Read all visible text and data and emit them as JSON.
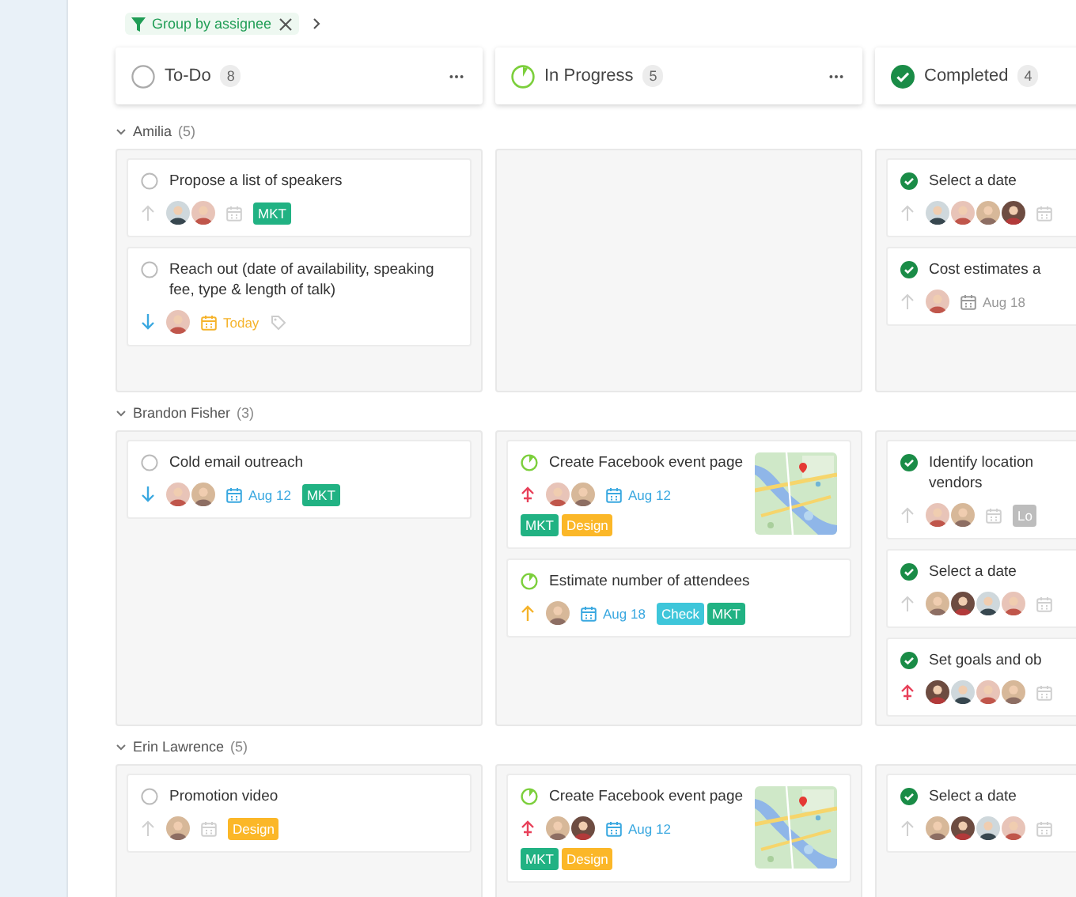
{
  "toolbar": {
    "filter_chip": {
      "label": "Group by assignee"
    },
    "next": true
  },
  "columns": [
    {
      "title": "To-Do",
      "count": "8",
      "kind": "todo"
    },
    {
      "title": "In Progress",
      "count": "5",
      "kind": "progress"
    },
    {
      "title": "Completed",
      "count": "4",
      "kind": "done"
    }
  ],
  "groups": [
    {
      "name": "Amilia",
      "count": "(5)",
      "expanded": true,
      "lanes": [
        {
          "kind": "cards",
          "cards": [
            {
              "title": "Propose a list of speakers",
              "kind": "todo",
              "priority": {
                "kind": "none"
              },
              "avatars": [
                {
                  "kind": "picture"
                },
                {
                  "kind": "picture"
                }
              ],
              "due": {
                "kind": "none"
              },
              "tags": [
                {
                  "label": "MKT",
                  "color": "#21b283"
                }
              ]
            },
            {
              "title": "Reach out (date of availability, speaking fee, type & length of talk)",
              "kind": "todo",
              "priority": {
                "kind": "low"
              },
              "avatars": [
                {
                  "kind": "picture"
                }
              ],
              "due": {
                "kind": "today",
                "label": "Today"
              },
              "tag_icon": true
            }
          ]
        },
        {
          "kind": "empty"
        },
        {
          "kind": "cards",
          "cards": [
            {
              "title": "Select a date",
              "kind": "done",
              "priority": {
                "kind": "none"
              },
              "avatars": [
                {
                  "kind": "picture"
                },
                {
                  "kind": "picture"
                },
                {
                  "kind": "picture"
                },
                {
                  "kind": "picture"
                }
              ],
              "due": {
                "kind": "none"
              }
            },
            {
              "title": "Cost estimates a",
              "kind": "done",
              "priority": {
                "kind": "none"
              },
              "avatars": [
                {
                  "kind": "picture"
                }
              ],
              "due": {
                "kind": "past",
                "label": "Aug 18"
              }
            }
          ]
        }
      ]
    },
    {
      "name": "Brandon Fisher",
      "count": "(3)",
      "expanded": true,
      "lanes": [
        {
          "kind": "cards",
          "cards": [
            {
              "title": "Cold email outreach",
              "kind": "todo",
              "priority": {
                "kind": "low"
              },
              "avatars": [
                {
                  "kind": "picture"
                },
                {
                  "kind": "picture"
                }
              ],
              "due": {
                "kind": "upcoming",
                "label": "Aug 12"
              },
              "tags": [
                {
                  "label": "MKT",
                  "color": "#21b283"
                }
              ]
            }
          ]
        },
        {
          "kind": "cards",
          "cards": [
            {
              "title": "Create Facebook event page",
              "kind": "progress",
              "priority": {
                "kind": "high"
              },
              "avatars": [
                {
                  "kind": "picture"
                },
                {
                  "kind": "picture"
                }
              ],
              "due": {
                "kind": "upcoming",
                "label": "Aug 12"
              },
              "tags": [
                {
                  "label": "MKT",
                  "color": "#21b283"
                },
                {
                  "label": "Design",
                  "color": "#fbb728"
                }
              ],
              "thumbnail": {
                "kind": "picture"
              }
            },
            {
              "title": "Estimate number of attendees",
              "kind": "progress",
              "priority": {
                "kind": "medium"
              },
              "avatars": [
                {
                  "kind": "picture"
                }
              ],
              "due": {
                "kind": "upcoming",
                "label": "Aug 18"
              },
              "tags": [
                {
                  "label": "Check",
                  "color": "#3ec6da"
                },
                {
                  "label": "MKT",
                  "color": "#21b283"
                }
              ]
            }
          ]
        },
        {
          "kind": "cards",
          "cards": [
            {
              "title": "Identify location\nvendors",
              "kind": "done",
              "priority": {
                "kind": "none"
              },
              "avatars": [
                {
                  "kind": "picture"
                },
                {
                  "kind": "picture"
                }
              ],
              "due": {
                "kind": "none"
              },
              "tags": [
                {
                  "label": "Lo",
                  "color": "#bdbdbd"
                }
              ]
            },
            {
              "title": "Select a date",
              "kind": "done",
              "priority": {
                "kind": "none"
              },
              "avatars": [
                {
                  "kind": "picture"
                },
                {
                  "kind": "picture"
                },
                {
                  "kind": "picture"
                },
                {
                  "kind": "picture"
                }
              ],
              "due": {
                "kind": "none"
              }
            },
            {
              "title": "Set goals and ob",
              "kind": "done",
              "priority": {
                "kind": "high"
              },
              "avatars": [
                {
                  "kind": "picture"
                },
                {
                  "kind": "picture"
                },
                {
                  "kind": "picture"
                },
                {
                  "kind": "picture"
                }
              ],
              "due": {
                "kind": "none"
              }
            }
          ]
        }
      ]
    },
    {
      "name": "Erin Lawrence",
      "count": "(5)",
      "expanded": true,
      "lanes": [
        {
          "kind": "cards",
          "cards": [
            {
              "title": "Promotion video",
              "kind": "todo",
              "priority": {
                "kind": "none"
              },
              "avatars": [
                {
                  "kind": "picture"
                }
              ],
              "due": {
                "kind": "none"
              },
              "tags": [
                {
                  "label": "Design",
                  "color": "#fbb728"
                }
              ]
            }
          ]
        },
        {
          "kind": "cards",
          "cards": [
            {
              "title": "Create Facebook event page",
              "kind": "progress",
              "priority": {
                "kind": "high"
              },
              "avatars": [
                {
                  "kind": "picture"
                },
                {
                  "kind": "picture"
                }
              ],
              "due": {
                "kind": "upcoming",
                "label": "Aug 12"
              },
              "tags": [
                {
                  "label": "MKT",
                  "color": "#21b283"
                },
                {
                  "label": "Design",
                  "color": "#fbb728"
                }
              ],
              "thumbnail": {
                "kind": "picture"
              }
            }
          ]
        },
        {
          "kind": "cards",
          "cards": [
            {
              "title": "Select a date",
              "kind": "done",
              "priority": {
                "kind": "none"
              },
              "avatars": [
                {
                  "kind": "picture"
                },
                {
                  "kind": "picture"
                },
                {
                  "kind": "picture"
                },
                {
                  "kind": "picture"
                }
              ],
              "due": {
                "kind": "none"
              }
            }
          ]
        }
      ]
    }
  ]
}
